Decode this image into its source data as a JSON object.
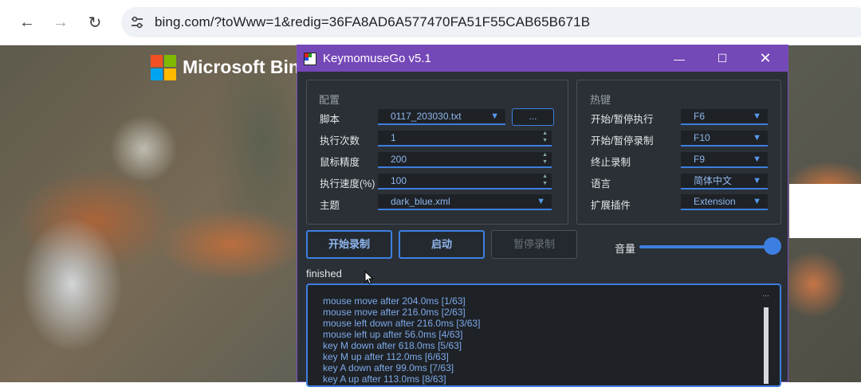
{
  "browser": {
    "back_icon": "←",
    "forward_icon": "→",
    "reload_icon": "↻",
    "url": "bing.com/?toWww=1&redig=36FA8AD6A577470FA51F55CAB65B671B"
  },
  "page": {
    "brand": "Microsoft Bing",
    "logo_colors": [
      "#f25022",
      "#7fba00",
      "#00a4ef",
      "#ffb900"
    ]
  },
  "app": {
    "title": "KeymomuseGo v5.1",
    "accent": "#3d7fe0",
    "titlebar_color": "#7548b8",
    "minimize_icon": "—",
    "maximize_icon": "☐",
    "close_icon": "✕",
    "config": {
      "title": "配置",
      "rows": [
        {
          "label": "脚本",
          "value": "0117_203030.txt",
          "control": "dropdown"
        },
        {
          "label": "执行次数",
          "value": "1",
          "control": "spinbox"
        },
        {
          "label": "鼠标精度",
          "value": "200",
          "control": "spinbox"
        },
        {
          "label": "执行速度(%)",
          "value": "100",
          "control": "spinbox"
        },
        {
          "label": "主题",
          "value": "dark_blue.xml",
          "control": "dropdown"
        }
      ],
      "browse_label": "..."
    },
    "hotkeys": {
      "title": "热键",
      "rows": [
        {
          "label": "开始/暂停执行",
          "value": "F6"
        },
        {
          "label": "开始/暂停录制",
          "value": "F10"
        },
        {
          "label": "终止录制",
          "value": "F9"
        },
        {
          "label": "语言",
          "value": "简体中文"
        },
        {
          "label": "扩展插件",
          "value": "Extension"
        }
      ]
    },
    "buttons": {
      "start_record": "开始录制",
      "launch": "启动",
      "pause_record": "暂停录制"
    },
    "volume": {
      "label": "音量",
      "level": 1.0
    },
    "status": "finished",
    "log": [
      "mouse move after 204.0ms [1/63]",
      "mouse move after 216.0ms [2/63]",
      "mouse left down after 216.0ms [3/63]",
      "mouse left up after 56.0ms [4/63]",
      "key M down after 618.0ms [5/63]",
      "key M up after 112.0ms [6/63]",
      "key A down after 99.0ms [7/63]",
      "key A up after 113.0ms [8/63]"
    ]
  }
}
